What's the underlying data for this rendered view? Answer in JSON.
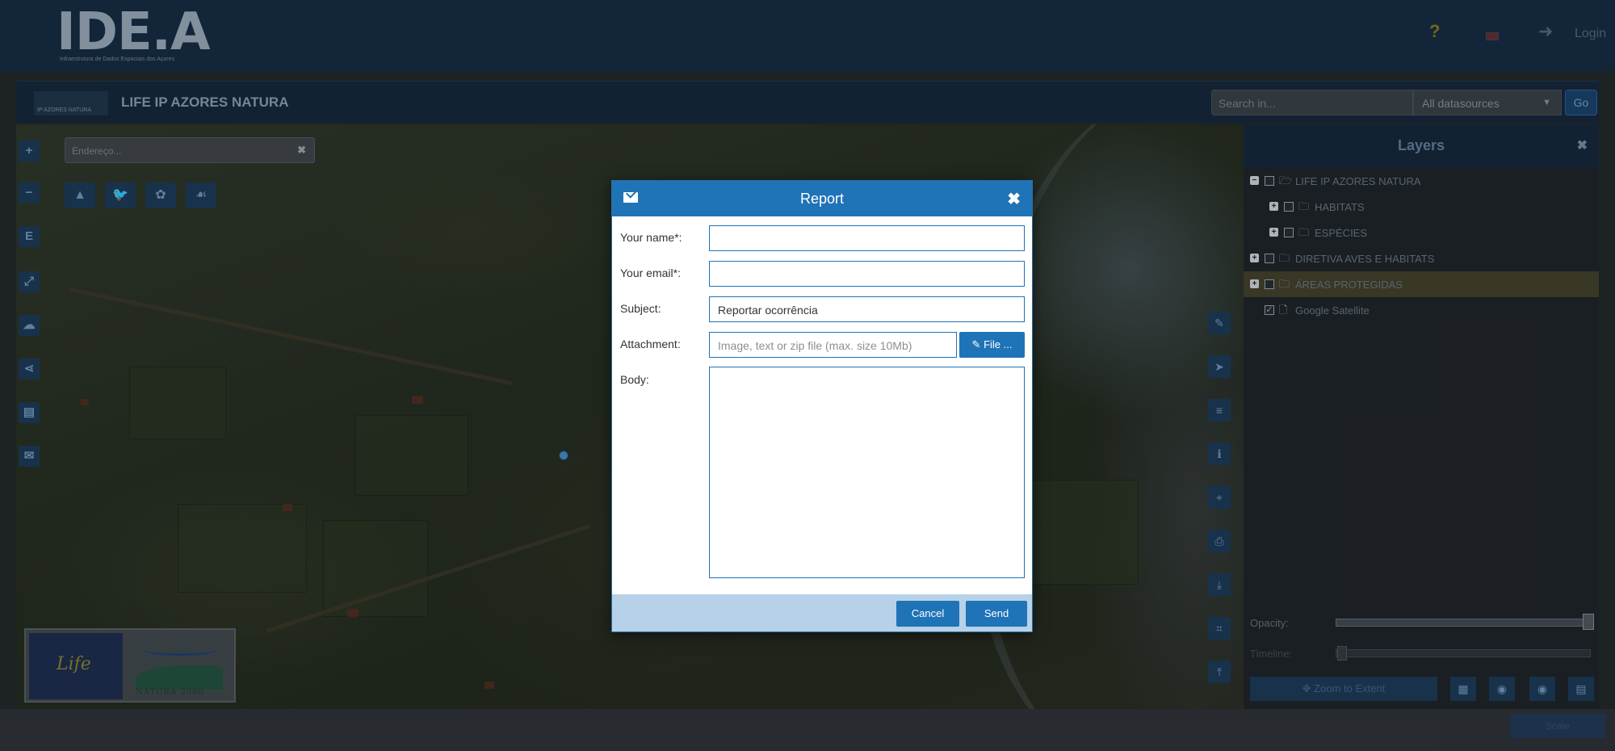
{
  "header": {
    "logo_text": "IDE.A",
    "logo_subtitle": "Infraestrutura de Dados Espaciais dos Açores",
    "help_label": "?",
    "login_label": "Login"
  },
  "project": {
    "title": "LIFE IP AZORES NATURA",
    "logo_text": "IP AZORES NATURA",
    "search_placeholder": "Search in...",
    "datasource_selected": "All datasources",
    "go_label": "Go"
  },
  "map": {
    "address_placeholder": "Endereço...",
    "address_clear": "✖",
    "left_tools": [
      "+",
      "−",
      "E",
      "⤢",
      "☁",
      "⋖",
      "▤",
      "✉"
    ],
    "species_tools": [
      "▲",
      "🐦",
      "✿",
      "☙"
    ],
    "right_tools": [
      "✎",
      "➤",
      "≡",
      "ℹ",
      "⌖",
      "⎙",
      "⤓",
      "⌗",
      "⤒"
    ]
  },
  "logos": {
    "life_label": "Life",
    "natura_label": "NATURA 2000"
  },
  "layers": {
    "title": "Layers",
    "close": "✖",
    "items": [
      {
        "name": "LIFE IP AZORES NATURA",
        "expander": "−",
        "checked": false
      },
      {
        "name": "HABITATS",
        "expander": "+",
        "checked": false
      },
      {
        "name": "ESPÉCIES",
        "expander": "+",
        "checked": false
      },
      {
        "name": "DIRETIVA AVES E HABITATS",
        "expander": "+",
        "checked": false
      },
      {
        "name": "ÁREAS PROTEGIDAS",
        "expander": "+",
        "checked": false
      },
      {
        "name": "Google Satellite",
        "expander": "",
        "checked": true
      }
    ],
    "opacity_label": "Opacity:",
    "opacity_value": 1.0,
    "timeline_label": "Timeline:",
    "zoom_extent_label": "Zoom to Extent",
    "scale_label": "Scale"
  },
  "report": {
    "title": "Report",
    "close": "✖",
    "name_label": "Your name*:",
    "name_value": "",
    "email_label": "Your email*:",
    "email_value": "",
    "subject_label": "Subject:",
    "subject_value": "Reportar ocorrência",
    "attachment_label": "Attachment:",
    "attachment_placeholder": "Image, text or zip file (max. size 10Mb)",
    "file_button_label": "File ...",
    "body_label": "Body:",
    "body_value": "",
    "cancel_label": "Cancel",
    "send_label": "Send"
  },
  "colors": {
    "primary": "#1f73b7",
    "header_dark": "#15283b",
    "footer_light": "#b7d2e8"
  }
}
